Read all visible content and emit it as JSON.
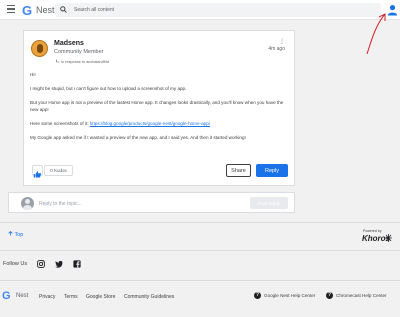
{
  "header": {
    "logo_letter": "G",
    "brand": "Nest",
    "search_placeholder": "Search all content"
  },
  "post": {
    "author": "Madsens",
    "rank": "Community Member",
    "reply_prefix": "In response to",
    "reply_to": "anchalaruff4d",
    "timestamp": "4m ago",
    "menu": "⋮",
    "paragraphs": [
      "Hi!",
      "I might be stupid, but i can't figure out how to upload a screenshot of my app.",
      "But your Home app is not a preview of the lastest Home app. It changes looks drastically, and you'll know when you have the new app!",
      "Here some screenshots of it: ",
      "My Google app asked me if I wanted a preview of the new app, and I said yes. And then it started working!"
    ],
    "link": "https://blog.google/products/google-nest/google-home-app/",
    "kudos": "0 Kudos",
    "share_label": "Share",
    "reply_label": "Reply"
  },
  "reply_box": {
    "placeholder": "Reply to the topic...",
    "post_label": "Post Reply"
  },
  "footer": {
    "top_label": "Top",
    "powered_by": "Powered by",
    "khoros": "Khoros",
    "follow_us": "Follow Us",
    "logo_letter": "G",
    "brand": "Nest",
    "links": [
      "Privacy",
      "Terms",
      "Google Store",
      "Community Guidelines"
    ],
    "help_links": [
      "Google Nest Help Center",
      "Chromecast Help Center"
    ],
    "help_icon": "?"
  },
  "colors": {
    "accent": "#1a73e8",
    "annotation": "#d21f26",
    "user_icon": "#1a73e8"
  },
  "icons": [
    "hamburger-icon",
    "search-icon",
    "user-icon",
    "like-icon",
    "instagram-icon",
    "twitter-icon",
    "facebook-icon",
    "help-icon",
    "khoros-icon"
  ]
}
